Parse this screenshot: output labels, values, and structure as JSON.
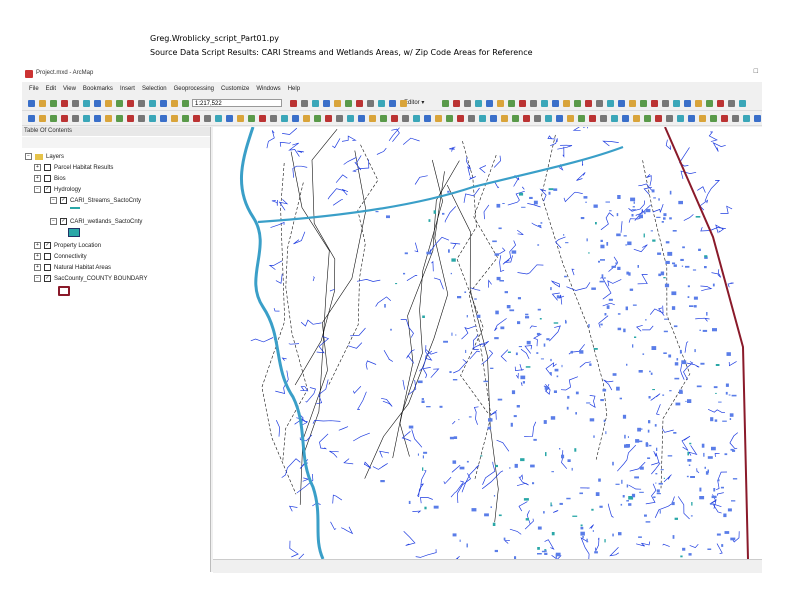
{
  "caption": {
    "line1": "Greg.Wroblicky_script_Part01.py",
    "line2": "Source Data Script Results: CARI Streams and Wetlands Areas, w/ Zip Code Areas for Reference"
  },
  "window": {
    "title": "Project.mxd - ArcMap",
    "controls": "□"
  },
  "menu": [
    "File",
    "Edit",
    "View",
    "Bookmarks",
    "Insert",
    "Selection",
    "Geoprocessing",
    "Customize",
    "Windows",
    "Help"
  ],
  "toolbar": {
    "scale": "1:217,522",
    "editor_label": "Editor ▾"
  },
  "toc": {
    "title": "Table Of Contents",
    "layers_label": "Layers",
    "items": [
      {
        "label": "Parcel Habitat Results"
      },
      {
        "label": "Bios"
      },
      {
        "label": "Hydrology"
      },
      {
        "label": "CARI_Streams_SactoCnty"
      },
      {
        "label": "CARI_wetlands_SactoCnty"
      },
      {
        "label": "Property Location"
      },
      {
        "label": "Connectivity"
      },
      {
        "label": "Natural Habitat Areas"
      },
      {
        "label": "SacCounty_COUNTY BOUNDARY"
      }
    ]
  },
  "colors": {
    "stream": "#1f3de0",
    "wetland": "#5a7de8",
    "wetland_teal": "#2aa7a7",
    "river": "#3a9fc8",
    "boundary": "#8a1a2a",
    "zip_line": "#111111",
    "county_fill": "#ffffff",
    "outside_fill": "#ffffff"
  }
}
